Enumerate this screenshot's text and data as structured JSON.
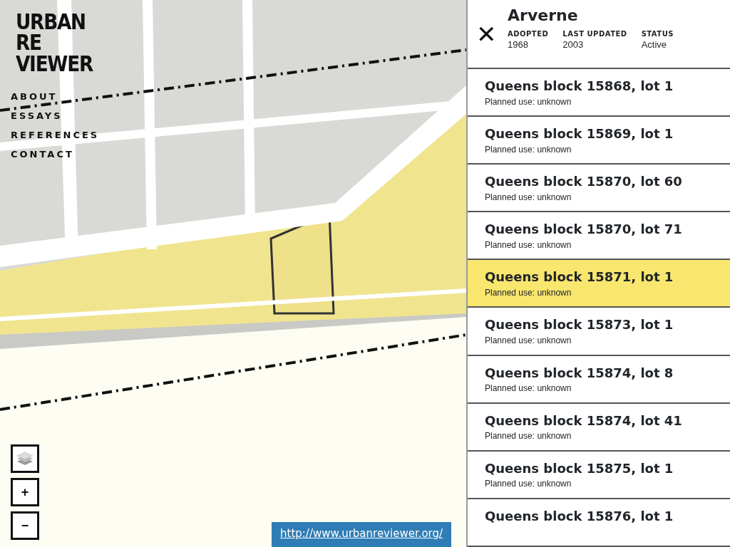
{
  "logo": {
    "lines": [
      "URBAN",
      "RE",
      "VIEWER"
    ]
  },
  "nav": [
    {
      "label": "ABOUT"
    },
    {
      "label": "ESSAYS"
    },
    {
      "label": "REFERENCES"
    },
    {
      "label": "CONTACT"
    }
  ],
  "map_controls": [
    {
      "kind": "layers"
    },
    {
      "kind": "text",
      "label": "+"
    },
    {
      "kind": "text",
      "label": "−"
    }
  ],
  "link": "http://www.urbanreviewer.org/",
  "plan": {
    "title": "Arverne",
    "close": "✕",
    "facts": [
      {
        "label": "ADOPTED",
        "value": "1968"
      },
      {
        "label": "LAST UPDATED",
        "value": "2003"
      },
      {
        "label": "STATUS",
        "value": "Active"
      }
    ]
  },
  "lots": [
    {
      "title": "Queens block 15868, lot 1",
      "use": "Planned use: unknown",
      "selected": false
    },
    {
      "title": "Queens block 15869, lot 1",
      "use": "Planned use: unknown",
      "selected": false
    },
    {
      "title": "Queens block 15870, lot 60",
      "use": "Planned use: unknown",
      "selected": false
    },
    {
      "title": "Queens block 15870, lot 71",
      "use": "Planned use: unknown",
      "selected": false
    },
    {
      "title": "Queens block 15871, lot 1",
      "use": "Planned use: unknown",
      "selected": true
    },
    {
      "title": "Queens block 15873, lot 1",
      "use": "Planned use: unknown",
      "selected": false
    },
    {
      "title": "Queens block 15874, lot 8",
      "use": "Planned use: unknown",
      "selected": false
    },
    {
      "title": "Queens block 15874, lot 41",
      "use": "Planned use: unknown",
      "selected": false
    },
    {
      "title": "Queens block 15875, lot 1",
      "use": "Planned use: unknown",
      "selected": false
    },
    {
      "title": "Queens block 15876, lot 1",
      "selected": false
    }
  ]
}
